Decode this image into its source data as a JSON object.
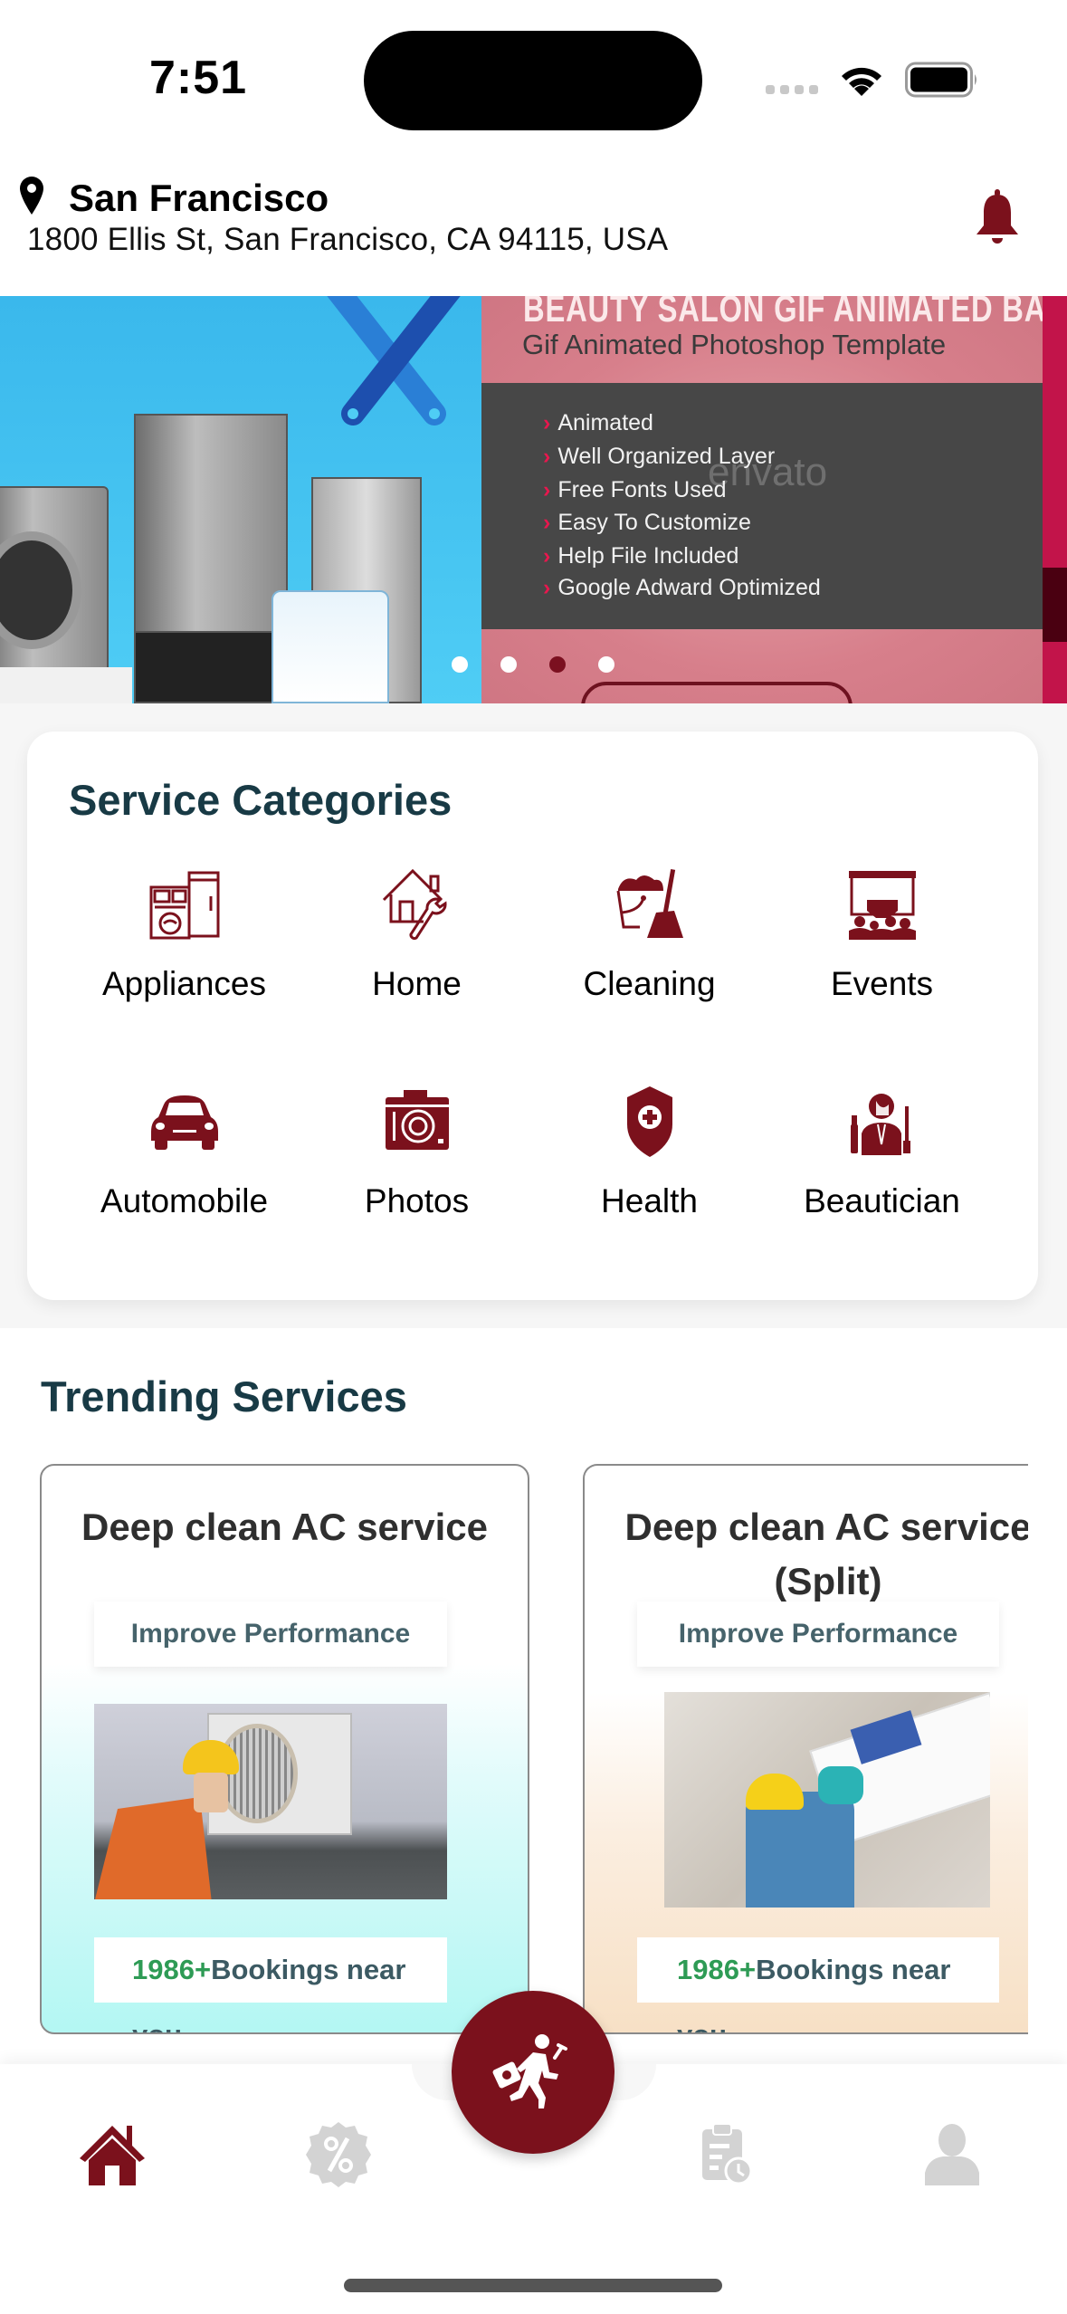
{
  "status_bar": {
    "time": "7:51"
  },
  "header": {
    "city": "San Francisco",
    "address": "1800 Ellis St, San Francisco, CA 94115, USA"
  },
  "banner": {
    "slides": [
      {
        "name": "appliances-repair"
      },
      {
        "name": "beauty-salon",
        "title": "BEAUTY SALON GIF ANIMATED BANNER",
        "subtitle": "Gif Animated Photoshop Template",
        "features": [
          "Animated",
          "Well Organized Layer",
          "Free Fonts Used",
          "Easy To Customize",
          "Help File Included",
          "Google Adward Optimized"
        ],
        "watermark": "envato"
      },
      {
        "name": "third-slide"
      }
    ],
    "dot_count": 4,
    "active_dot": 3
  },
  "categories": {
    "title": "Service Categories",
    "items": [
      {
        "label": "Appliances",
        "icon": "appliances-icon"
      },
      {
        "label": "Home",
        "icon": "home-repair-icon"
      },
      {
        "label": "Cleaning",
        "icon": "cleaning-icon"
      },
      {
        "label": "Events",
        "icon": "events-icon"
      },
      {
        "label": "Automobile",
        "icon": "car-icon"
      },
      {
        "label": "Photos",
        "icon": "camera-icon"
      },
      {
        "label": "Health",
        "icon": "health-shield-icon"
      },
      {
        "label": "Beautician",
        "icon": "beautician-icon"
      }
    ]
  },
  "trending": {
    "title": "Trending Services",
    "cards": [
      {
        "title": "Deep clean AC service",
        "badge": "Improve Performance",
        "bookings_count": "1986+",
        "bookings_text": "Bookings near you"
      },
      {
        "title": "Deep clean AC service (Split)",
        "badge": "Improve Performance",
        "bookings_count": "1986+",
        "bookings_text": "Bookings near you"
      }
    ]
  },
  "bottom_nav": {
    "items": [
      {
        "name": "home",
        "active": true
      },
      {
        "name": "offers",
        "active": false
      },
      {
        "name": "book-service",
        "active": false
      },
      {
        "name": "bookings",
        "active": false
      },
      {
        "name": "profile",
        "active": false
      }
    ]
  },
  "colors": {
    "brand": "#7b111c",
    "heading": "#183a45",
    "bookings_count": "#2e9b55",
    "inactive_icon": "#d0d0d0"
  }
}
